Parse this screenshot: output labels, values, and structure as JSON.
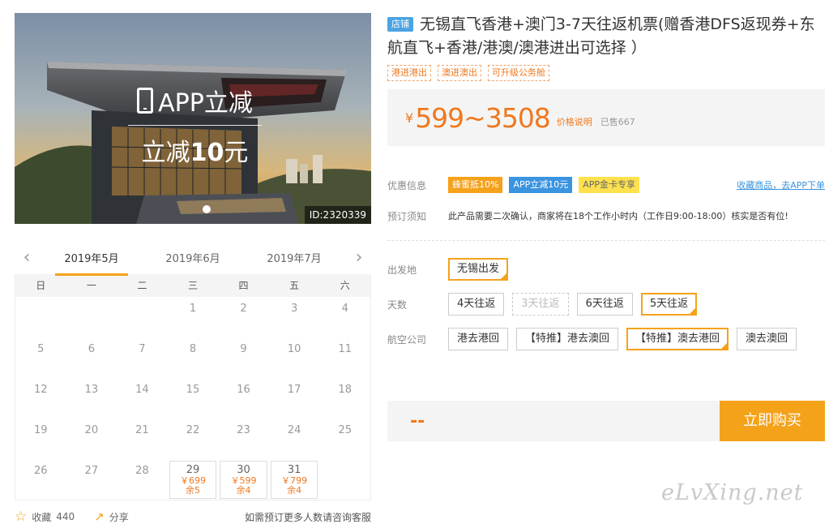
{
  "hero": {
    "promo_title": "APP立减",
    "promo_sub_prefix": "立减",
    "promo_sub_amount": "10",
    "promo_sub_unit": "元",
    "id_label": "ID:2320339"
  },
  "calendar": {
    "months": [
      {
        "label": "2019年5月",
        "active": true
      },
      {
        "label": "2019年6月",
        "active": false
      },
      {
        "label": "2019年7月",
        "active": false
      }
    ],
    "weekdays": [
      "日",
      "一",
      "二",
      "三",
      "四",
      "五",
      "六"
    ],
    "days": [
      "",
      "",
      "",
      "1",
      "2",
      "3",
      "4",
      "5",
      "6",
      "7",
      "8",
      "9",
      "10",
      "11",
      "12",
      "13",
      "14",
      "15",
      "16",
      "17",
      "18",
      "19",
      "20",
      "21",
      "22",
      "23",
      "24",
      "25",
      "26",
      "27",
      "28",
      "29",
      "30",
      "31",
      ""
    ],
    "available": {
      "29": {
        "price": "￥699",
        "stock": "余5"
      },
      "30": {
        "price": "￥599",
        "stock": "余4"
      },
      "31": {
        "price": "￥799",
        "stock": "余4"
      }
    }
  },
  "footer": {
    "fav_label": "收藏",
    "fav_count": "440",
    "share_label": "分享",
    "note": "如需预订更多人数请咨询客服"
  },
  "product": {
    "shop_badge": "店铺",
    "title": "无锡直飞香港+澳门3-7天往返机票(赠香港DFS返现券+东航直飞+香港/港澳/澳港进出可选择 ）",
    "tags": [
      "港进港出",
      "澳进澳出",
      "可升级公务舱"
    ],
    "currency": "¥",
    "price_range": "599~3508",
    "price_note": "价格说明",
    "sold": "已售667"
  },
  "discount": {
    "label": "优惠信息",
    "tags": [
      {
        "text": "蜂蜜抵10%",
        "color": "#f5a21b"
      },
      {
        "text": "APP立减10元",
        "color": "#3a94e0"
      },
      {
        "text": "APP金卡专享",
        "color": "#ffe14d"
      }
    ],
    "fav_link": "收藏商品，去APP下单"
  },
  "notice": {
    "label": "预订须知",
    "text": "此产品需要二次确认，商家将在18个工作小时内（工作日9:00-18:00）核实是否有位!"
  },
  "options": {
    "departure": {
      "label": "出发地",
      "items": [
        {
          "text": "无锡出发",
          "state": "selected"
        }
      ]
    },
    "days": {
      "label": "天数",
      "items": [
        {
          "text": "4天往返",
          "state": "normal"
        },
        {
          "text": "3天往返",
          "state": "disabled"
        },
        {
          "text": "6天往返",
          "state": "normal"
        },
        {
          "text": "5天往返",
          "state": "selected"
        }
      ]
    },
    "airline": {
      "label": "航空公司",
      "items": [
        {
          "text": "港去港回",
          "state": "normal"
        },
        {
          "text": "【特推】港去澳回",
          "state": "normal"
        },
        {
          "text": "【特推】澳去港回",
          "state": "selected"
        },
        {
          "text": "澳去澳回",
          "state": "normal"
        }
      ]
    }
  },
  "buy": {
    "total": "--",
    "button": "立即购买"
  },
  "watermark": "eLvXing.net",
  "colors": {
    "accent": "#f5a21b",
    "price": "#f0781e",
    "link": "#3a94e0"
  }
}
